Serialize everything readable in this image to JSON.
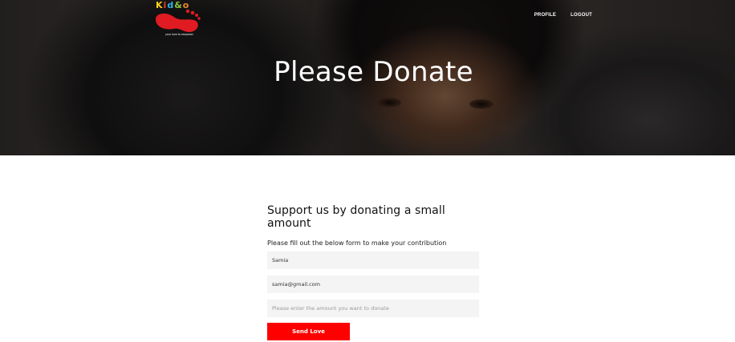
{
  "header": {
    "logo_text": [
      "K",
      "i",
      "d",
      "&",
      "o"
    ],
    "logo_tagline": "your love to empower",
    "nav": [
      {
        "label": "PROFILE"
      },
      {
        "label": "LOGOUT"
      }
    ],
    "hero_title": "Please Donate"
  },
  "form": {
    "heading": "Support us by donating a small amount",
    "subtext": "Please fill out the below form to make your contribution",
    "name_value": "Samia",
    "email_value": "samia@gmail.com",
    "amount_placeholder": "Please enter the amount you want to donate",
    "submit_label": "Send Love"
  },
  "colors": {
    "accent": "#ff0000",
    "field_bg": "#f4f4f4",
    "hero_text": "#ffffff"
  }
}
